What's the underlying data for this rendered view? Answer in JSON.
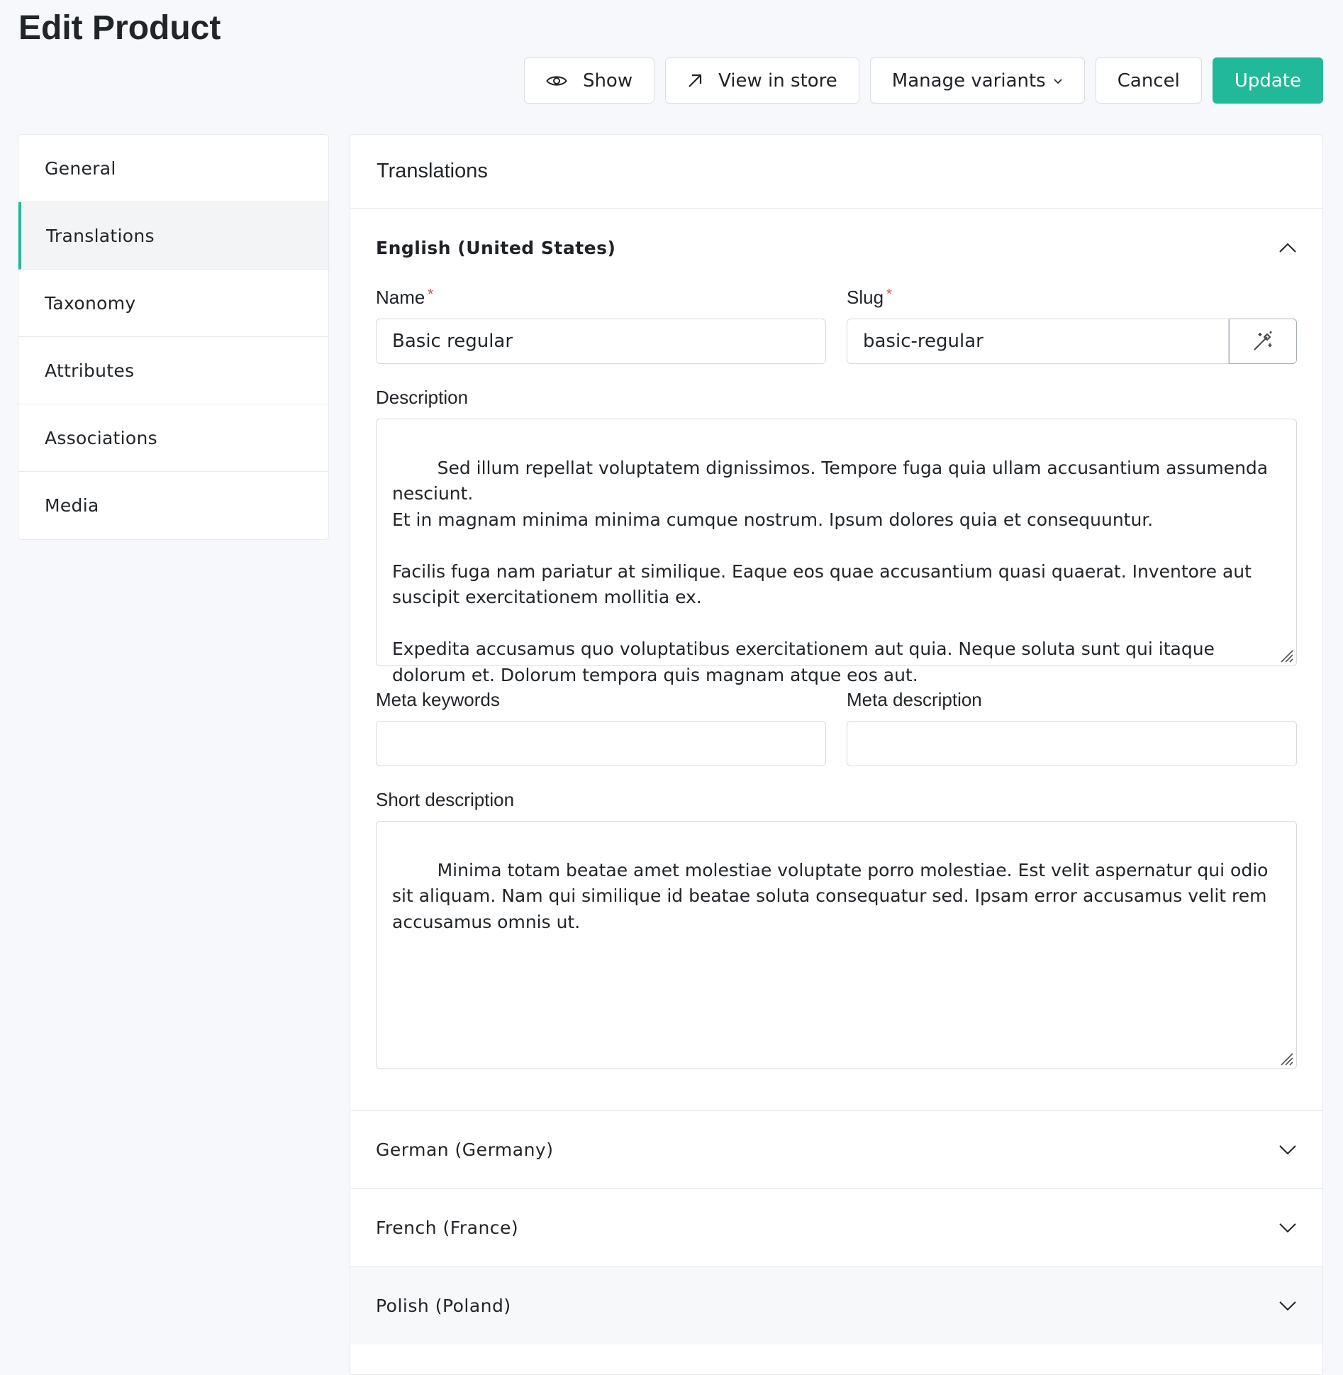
{
  "page": {
    "title": "Edit Product"
  },
  "actions": {
    "show": "Show",
    "view_in_store": "View in store",
    "manage_variants": "Manage variants",
    "cancel": "Cancel",
    "update": "Update"
  },
  "colors": {
    "accent": "#22b99a",
    "required": "#d9534f"
  },
  "sidebar": {
    "items": [
      {
        "label": "General"
      },
      {
        "label": "Translations",
        "active": true
      },
      {
        "label": "Taxonomy"
      },
      {
        "label": "Attributes"
      },
      {
        "label": "Associations"
      },
      {
        "label": "Media"
      }
    ]
  },
  "panel": {
    "title": "Translations",
    "locales": [
      {
        "name": "English (United States)",
        "expanded": true,
        "fields": {
          "name_label": "Name",
          "name_value": "Basic regular",
          "slug_label": "Slug",
          "slug_value": "basic-regular",
          "required_mark": "*",
          "description_label": "Description",
          "description_value": "Sed illum repellat voluptatem dignissimos. Tempore fuga quia ullam accusantium assumenda nesciunt.\nEt in magnam minima minima cumque nostrum. Ipsum dolores quia et consequuntur.\n\nFacilis fuga nam pariatur at similique. Eaque eos quae accusantium quasi quaerat. Inventore aut suscipit exercitationem mollitia ex.\n\nExpedita accusamus quo voluptatibus exercitationem aut quia. Neque soluta sunt qui itaque dolorum et. Dolorum tempora quis magnam atque eos aut.",
          "meta_keywords_label": "Meta keywords",
          "meta_keywords_value": "",
          "meta_description_label": "Meta description",
          "meta_description_value": "",
          "short_description_label": "Short description",
          "short_description_value": "Minima totam beatae amet molestiae voluptate porro molestiae. Est velit aspernatur qui odio sit aliquam. Nam qui similique id beatae soluta consequatur sed. Ipsam error accusamus velit rem accusamus omnis ut."
        }
      },
      {
        "name": "German (Germany)",
        "expanded": false
      },
      {
        "name": "French (France)",
        "expanded": false
      },
      {
        "name": "Polish (Poland)",
        "expanded": false
      }
    ]
  },
  "icons": {
    "show": "eye-icon",
    "view_in_store": "arrow-up-right-icon",
    "manage_variants": "chevron-down-icon",
    "slug_generate": "magic-wand-icon",
    "expanded": "chevron-up-icon",
    "collapsed": "chevron-down-icon"
  }
}
